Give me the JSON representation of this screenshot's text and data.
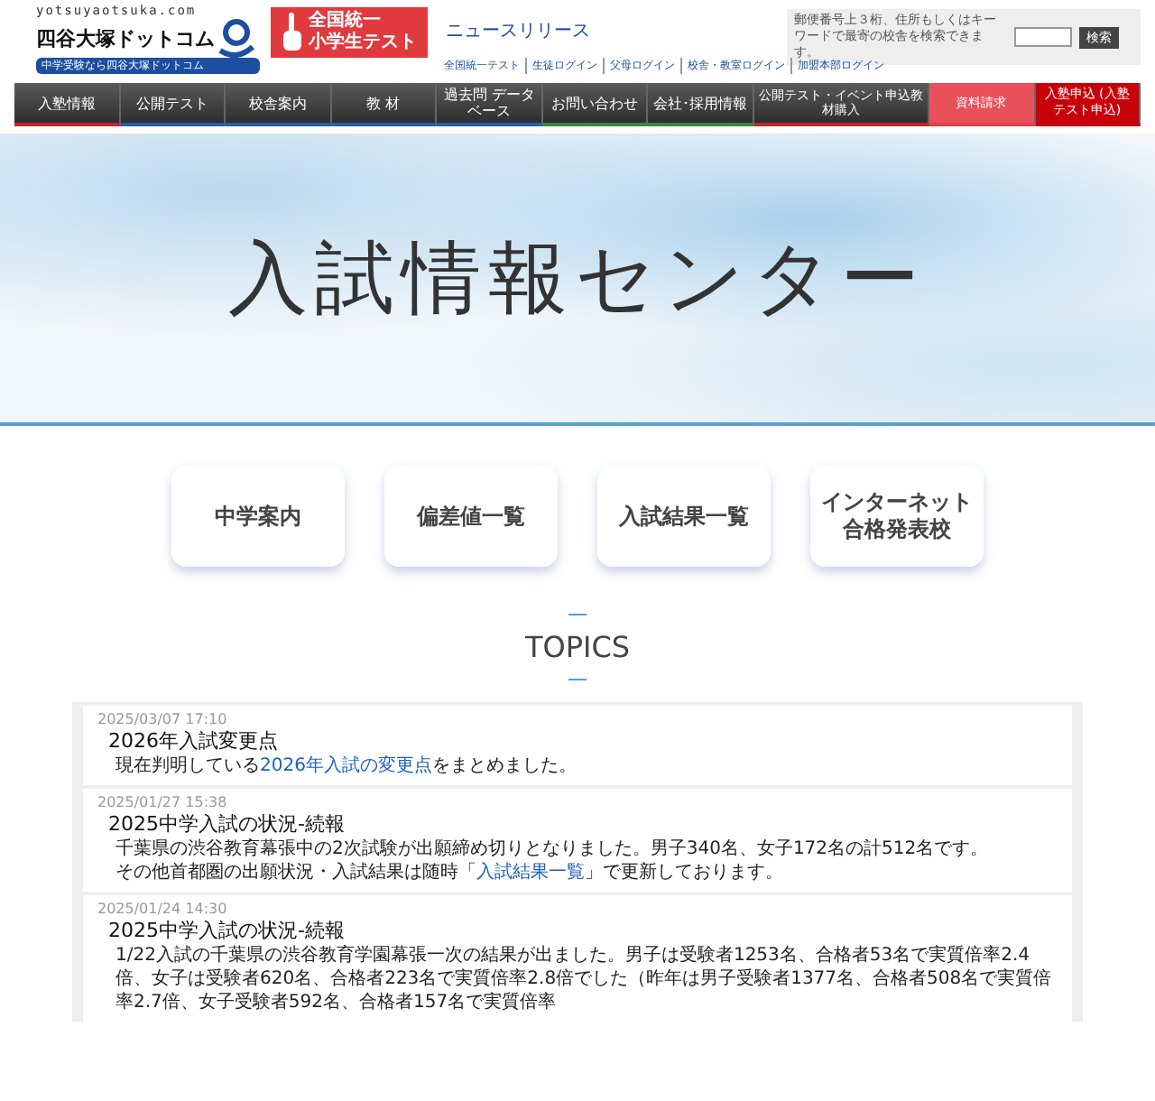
{
  "header": {
    "logo_url": "yotsuyaotsuka.com",
    "logo_name": "四谷大塚ドットコム",
    "logo_tagline": "中学受験なら四谷大塚ドットコム",
    "test_badge": [
      "全国統一",
      "小学生テスト"
    ],
    "news_link": "ニュースリリース",
    "search_hint": "郵便番号上３桁、住所もしくはキーワードで最寄の校舎を検索できます。",
    "search_button": "検索",
    "login_links": [
      "全国統一テスト",
      "生徒ログイン",
      "父母ログイン",
      "校舎・教室ログイン",
      "加盟本部ログイン"
    ]
  },
  "nav": [
    {
      "label": "入塾情報",
      "kind": "normal",
      "color": "#c0262d"
    },
    {
      "label": "公開テスト",
      "kind": "normal",
      "color": "#2a5caa"
    },
    {
      "label": "校舎案内",
      "kind": "normal",
      "color": "#2a5caa"
    },
    {
      "label": "教 材",
      "kind": "normal",
      "color": "#2a5caa"
    },
    {
      "label": "過去問 データベース",
      "kind": "normal",
      "color": "#2a5caa"
    },
    {
      "label": "お問い合わせ",
      "kind": "normal",
      "color": "#3a8a3a"
    },
    {
      "label": "会社･採用情報",
      "kind": "normal",
      "color": "#3a8a3a"
    },
    {
      "label": "公開テスト・イベント申込教材購入",
      "kind": "small",
      "color": "#c0262d"
    },
    {
      "label": "資料請求",
      "kind": "request",
      "color": "#e04048"
    },
    {
      "label": "入塾申込 (入塾テスト申込)",
      "kind": "apply",
      "color": "#c8000a"
    }
  ],
  "banner": {
    "title": "入試情報センター"
  },
  "quick_links": [
    "中学案内",
    "偏差値一覧",
    "入試結果一覧",
    "インターネット合格発表校"
  ],
  "topics": {
    "heading": "TOPICS",
    "items": [
      {
        "date": "2025/03/07 17:10",
        "title": "2026年入試変更点",
        "lines": [
          {
            "text": "現在判明している",
            "link": "2026年入試の変更点",
            "after": "をまとめました。"
          }
        ]
      },
      {
        "date": "2025/01/27 15:38",
        "title": "2025中学入試の状況-続報",
        "lines": [
          {
            "text": "千葉県の渋谷教育幕張中の2次試験が出願締め切りとなりました。男子340名、女子172名の計512名です。"
          },
          {
            "text": "その他首都圏の出願状況・入試結果は随時「",
            "link": "入試結果一覧",
            "after": "」で更新しております。"
          }
        ]
      },
      {
        "date": "2025/01/24 14:30",
        "title": "2025中学入試の状況-続報",
        "lines": [
          {
            "text": "1/22入試の千葉県の渋谷教育学園幕張一次の結果が出ました。男子は受験者1253名、合格者53名で実質倍率2.4倍、女子は受験者620名、合格者223名で実質倍率2.8倍でした（昨年は男子受験者1377名、合格者508名で実質倍率2.7倍、女子受験者592名、合格者157名で実質倍率"
          }
        ]
      }
    ]
  }
}
